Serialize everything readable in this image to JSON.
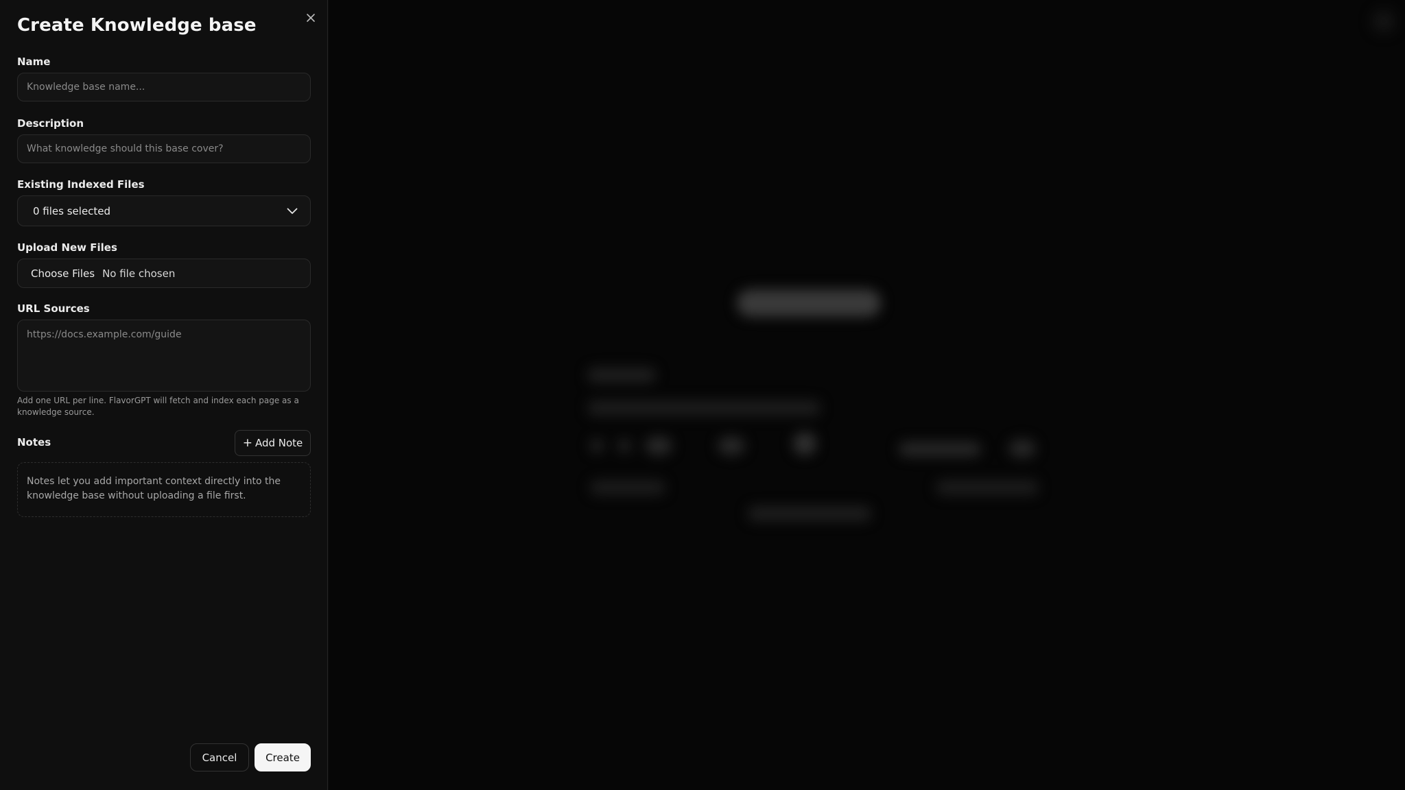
{
  "panel": {
    "title": "Create Knowledge base",
    "close_icon": "close-icon"
  },
  "fields": {
    "name": {
      "label": "Name",
      "value": "",
      "placeholder": "Knowledge base name..."
    },
    "description": {
      "label": "Description",
      "value": "",
      "placeholder": "What knowledge should this base cover?"
    },
    "existing_files": {
      "label": "Existing Indexed Files",
      "selected": "0 files selected",
      "icon": "chevron-down-icon"
    },
    "upload": {
      "label": "Upload New Files",
      "button_label": "Choose Files",
      "status": "No file chosen"
    },
    "url_sources": {
      "label": "URL Sources",
      "value": "",
      "placeholder": "https://docs.example.com/guide",
      "helper": "Add one URL per line. FlavorGPT will fetch and index each page as a knowledge source."
    },
    "notes": {
      "label": "Notes",
      "add_label": "Add Note",
      "add_icon": "plus-icon",
      "hint": "Notes let you add important context directly into the knowledge base without uploading a file first."
    }
  },
  "actions": {
    "cancel_label": "Cancel",
    "create_label": "Create"
  },
  "colors": {
    "panel_bg": "#0f0f0f",
    "input_bg": "#141414",
    "border": "#2a2a2a",
    "primary_button_bg": "#f5f5f5",
    "primary_button_text": "#111111"
  }
}
